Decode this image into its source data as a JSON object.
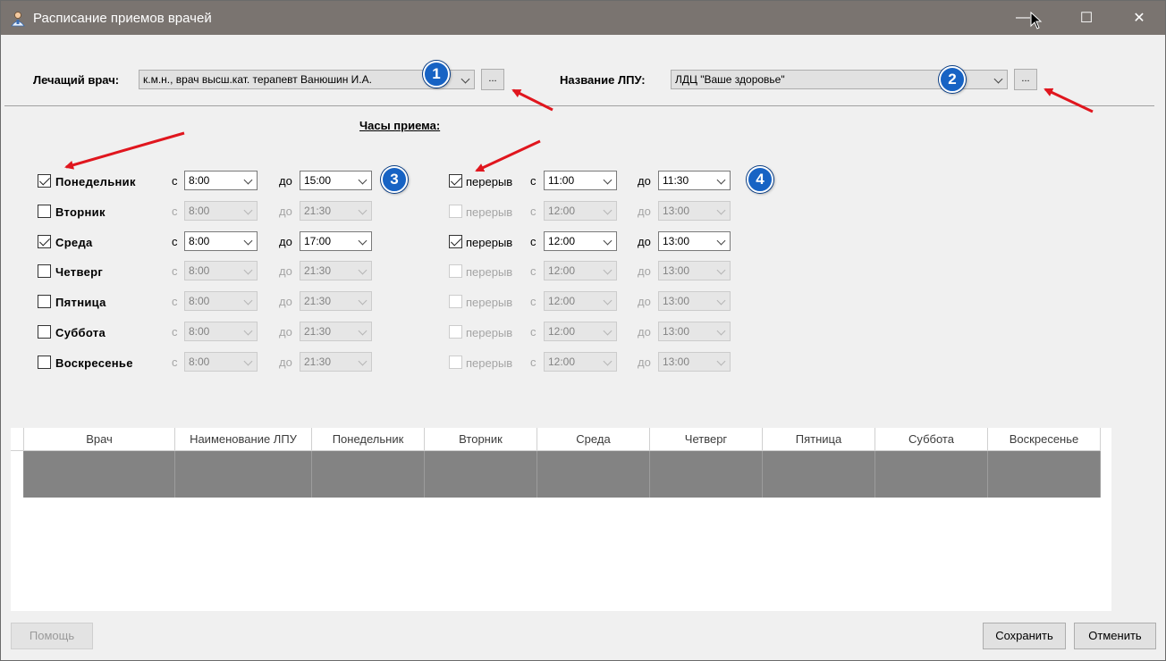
{
  "window": {
    "title": "Расписание приемов врачей",
    "controls": {
      "minimize": "—",
      "maximize": "☐",
      "close": "✕"
    }
  },
  "doctor": {
    "label": "Лечащий врач:",
    "value": "к.м.н., врач высш.кат. терапевт Ванюшин И.А.",
    "browse_label": "..."
  },
  "clinic": {
    "label": "Название ЛПУ:",
    "value": "ЛДЦ \"Ваше здоровье\"",
    "browse_label": "..."
  },
  "hours_title": "Часы приема:",
  "from_label": "с",
  "to_label": "до",
  "break_label": "перерыв",
  "days": [
    {
      "name": "Понедельник",
      "enabled": true,
      "from": "8:00",
      "to": "15:00",
      "break": true,
      "break_from": "11:00",
      "break_to": "11:30"
    },
    {
      "name": "Вторник",
      "enabled": false,
      "from": "8:00",
      "to": "21:30",
      "break": false,
      "break_from": "12:00",
      "break_to": "13:00"
    },
    {
      "name": "Среда",
      "enabled": true,
      "from": "8:00",
      "to": "17:00",
      "break": true,
      "break_from": "12:00",
      "break_to": "13:00"
    },
    {
      "name": "Четверг",
      "enabled": false,
      "from": "8:00",
      "to": "21:30",
      "break": false,
      "break_from": "12:00",
      "break_to": "13:00"
    },
    {
      "name": "Пятница",
      "enabled": false,
      "from": "8:00",
      "to": "21:30",
      "break": false,
      "break_from": "12:00",
      "break_to": "13:00"
    },
    {
      "name": "Суббота",
      "enabled": false,
      "from": "8:00",
      "to": "21:30",
      "break": false,
      "break_from": "12:00",
      "break_to": "13:00"
    },
    {
      "name": "Воскресенье",
      "enabled": false,
      "from": "8:00",
      "to": "21:30",
      "break": false,
      "break_from": "12:00",
      "break_to": "13:00"
    }
  ],
  "badges": [
    "1",
    "2",
    "3",
    "4"
  ],
  "table": {
    "columns": [
      "Врач",
      "Наименование ЛПУ",
      "Понедельник",
      "Вторник",
      "Среда",
      "Четверг",
      "Пятница",
      "Суббота",
      "Воскресенье"
    ]
  },
  "buttons": {
    "help": "Помощь",
    "save": "Сохранить",
    "cancel": "Отменить"
  },
  "colors": {
    "titlebar": "#7a7470",
    "badge": "#1763c4",
    "arrow": "#e0161e",
    "grid_row": "#838383"
  }
}
